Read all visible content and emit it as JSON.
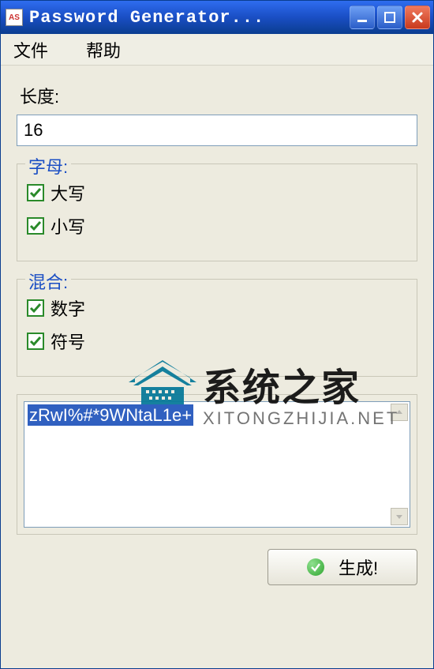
{
  "window": {
    "title": "Password Generator..."
  },
  "menu": {
    "file": "文件",
    "help": "帮助"
  },
  "length": {
    "label": "长度:",
    "value": "16"
  },
  "letters": {
    "legend": "字母:",
    "upper": {
      "label": "大写",
      "checked": true
    },
    "lower": {
      "label": "小写",
      "checked": true
    }
  },
  "mix": {
    "legend": "混合:",
    "digits": {
      "label": "数字",
      "checked": true
    },
    "symbols": {
      "label": "符号",
      "checked": true
    }
  },
  "output": {
    "value": "zRwI%#*9WNtaL1e+"
  },
  "buttons": {
    "generate": "生成!"
  },
  "watermark": {
    "cn": "系统之家",
    "en": "XITONGZHIJIA.NET"
  }
}
